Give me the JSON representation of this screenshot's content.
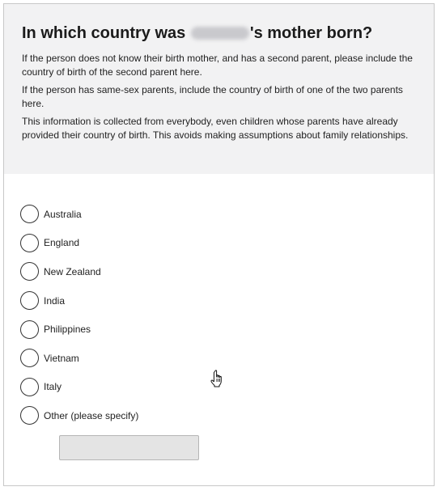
{
  "question": {
    "title_before": "In which country was",
    "title_after": "'s mother born?",
    "help": [
      "If the person does not know their birth mother, and has a second parent, please include the country of birth of the second parent here.",
      "If the person has same-sex parents, include the country of birth of one of the two parents here.",
      "This information is collected from everybody, even children whose parents have already provided their country of birth. This avoids making assumptions about family relationships."
    ]
  },
  "options": [
    "Australia",
    "England",
    "New Zealand",
    "India",
    "Philippines",
    "Vietnam",
    "Italy",
    "Other (please specify)"
  ],
  "other_input": {
    "value": "",
    "placeholder": ""
  },
  "cursor_icon": "hand-pointer-icon"
}
